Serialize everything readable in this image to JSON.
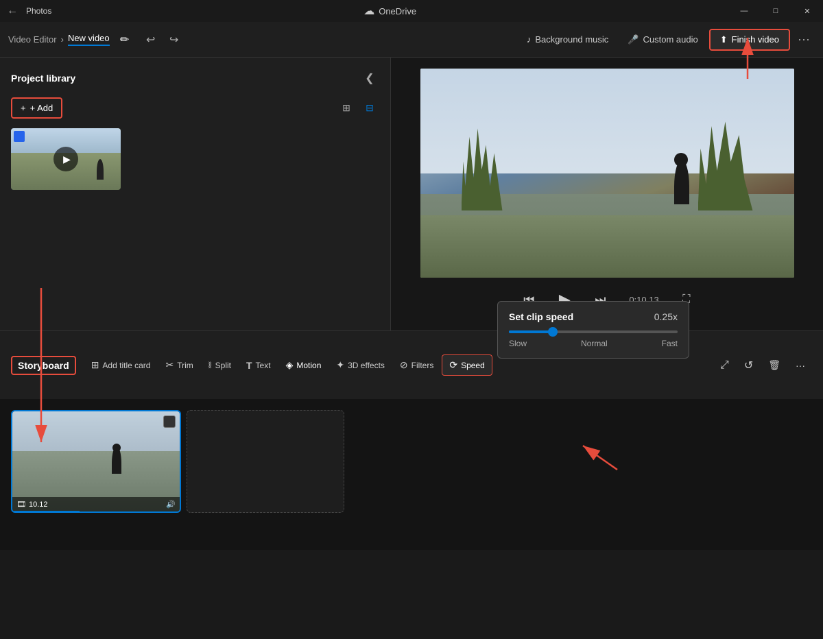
{
  "app": {
    "title": "Photos",
    "nav_back": "←"
  },
  "titlebar": {
    "title": "Photos",
    "minimize": "—",
    "maximize": "□",
    "close": "✕"
  },
  "toolbar": {
    "breadcrumb_home": "Video Editor",
    "breadcrumb_separator": "›",
    "project_name": "New video",
    "undo": "↩",
    "redo": "↪",
    "background_music_label": "Background music",
    "custom_audio_label": "Custom audio",
    "finish_video_label": "Finish video",
    "more_label": "···",
    "onedrive_label": "OneDrive"
  },
  "left_panel": {
    "title": "Project library",
    "add_button": "+ Add",
    "collapse_icon": "❮",
    "grid_view_icon": "⊞",
    "list_view_icon": "⊟",
    "thumbnail": {
      "play_icon": "▶"
    }
  },
  "preview": {
    "rewind_icon": "⏮",
    "play_icon": "▶",
    "forward_icon": "⏭",
    "time": "0:10.13",
    "fullscreen_icon": "⛶"
  },
  "speed_popup": {
    "title": "Set clip speed",
    "value": "0.25x",
    "label_slow": "Slow",
    "label_normal": "Normal",
    "label_fast": "Fast",
    "slider_percent": 23
  },
  "storyboard": {
    "label": "Storyboard",
    "tools": [
      {
        "id": "add-title-card",
        "icon": "⊞",
        "label": "Add title card"
      },
      {
        "id": "trim",
        "icon": "✂",
        "label": "Trim"
      },
      {
        "id": "split",
        "icon": "⧚",
        "label": "Split"
      },
      {
        "id": "text",
        "icon": "T",
        "label": "Text"
      },
      {
        "id": "motion",
        "icon": "◈",
        "label": "Motion"
      },
      {
        "id": "3d-effects",
        "icon": "✦",
        "label": "3D effects"
      },
      {
        "id": "filters",
        "icon": "⊘",
        "label": "Filters"
      },
      {
        "id": "speed",
        "icon": "⟳",
        "label": "Speed"
      },
      {
        "id": "resize",
        "icon": "⤢",
        "label": ""
      },
      {
        "id": "rotate",
        "icon": "↺",
        "label": ""
      },
      {
        "id": "delete",
        "icon": "🗑",
        "label": ""
      },
      {
        "id": "more-options",
        "icon": "···",
        "label": ""
      }
    ]
  },
  "timeline": {
    "clip": {
      "duration": "10.12",
      "audio_icon": "🔊",
      "video_icon": "🎞"
    }
  }
}
